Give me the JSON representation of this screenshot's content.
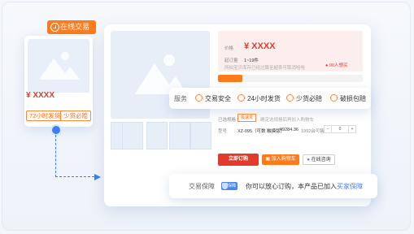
{
  "card": {
    "badge": "在线交易",
    "price": "¥ XXXX",
    "tag_1": "72小时发货",
    "tag_2": "少货必赔"
  },
  "product": {
    "price_label": "价格",
    "price": "¥ XXXX",
    "moq_label": "起订量",
    "moq_value": "1~19件",
    "note": "所拍宝贝库存已经过算至超卖可取消哈哈",
    "sold_label": "90人想买",
    "spec_label": "已选规格",
    "spec_value": "极速发",
    "spec_hint": "确定选规格后再加入购物车",
    "model_label": "型号",
    "model_value": "XZ-095（可数 触摸版）",
    "model_price": "¥9284.36",
    "stock": "1992台可售",
    "qty_minus": "−",
    "qty_value": "0",
    "qty_plus": "+"
  },
  "service": {
    "label": "服务",
    "items": [
      "交易安全",
      "24小时发货",
      "少货必赔",
      "破损包赔"
    ]
  },
  "buttons": {
    "buy": "立即订购",
    "cart": "加入购物车",
    "chat": "在线咨询"
  },
  "guarantee": {
    "label": "交易保障",
    "badge": "保障",
    "text": "你可以放心订购，本产品已加入",
    "link": "买家保障"
  },
  "colors": {
    "accent_orange": "#ff7a1a",
    "price_red": "#e23b2e",
    "brand_blue": "#3d7ff2"
  },
  "progress_fraction": 0.17
}
